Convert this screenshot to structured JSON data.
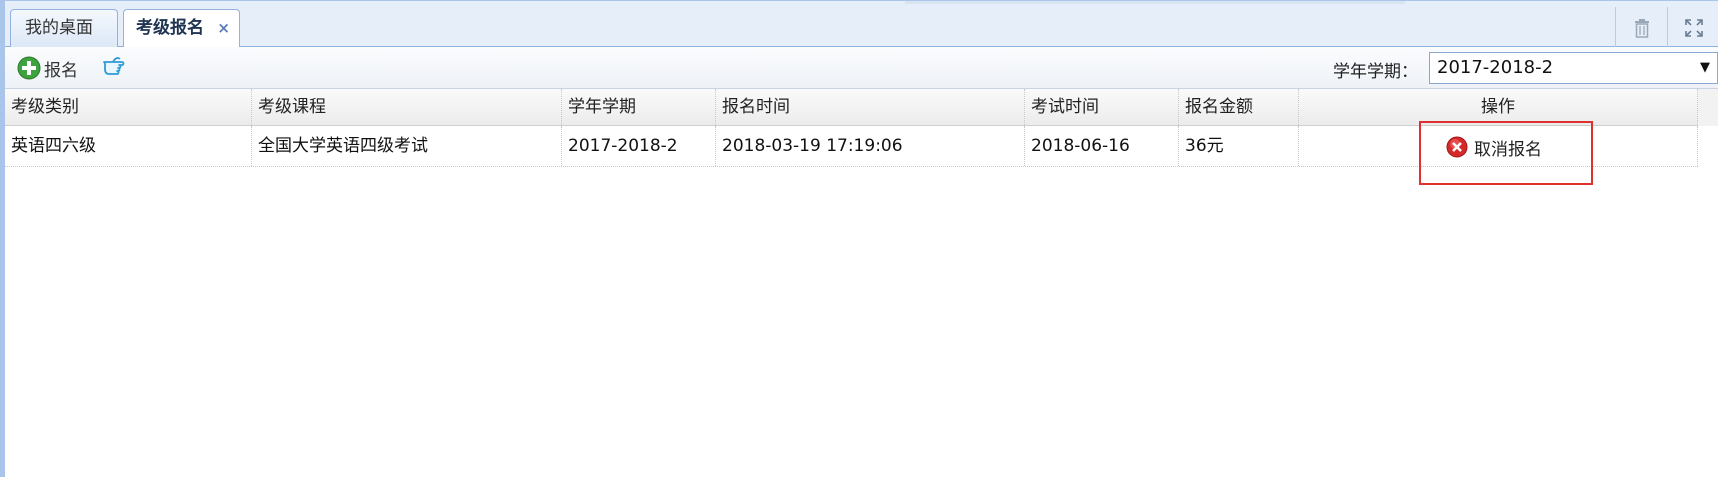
{
  "tabs": [
    {
      "label": "我的桌面",
      "active": false
    },
    {
      "label": "考级报名",
      "active": true,
      "close": "×"
    }
  ],
  "toolbar": {
    "register_label": "报名",
    "term_label": "学年学期：",
    "term_selected": "2017-2018-2"
  },
  "table": {
    "headers": [
      "考级类别",
      "考级课程",
      "学年学期",
      "报名时间",
      "考试时间",
      "报名金额",
      "操作"
    ],
    "rows": [
      {
        "category": "英语四六级",
        "course": "全国大学英语四级考试",
        "term": "2017-2018-2",
        "register_time": "2018-03-19 17:19:06",
        "exam_time": "2018-06-16",
        "fee": "36元",
        "action": "取消报名"
      }
    ]
  },
  "colors": {
    "accent": "#e03131",
    "tab_border": "#93b3de",
    "tabstrip_bg": "#e6eef9"
  },
  "icons": [
    "plus-icon",
    "pointing-hand-icon",
    "trash-icon",
    "fullscreen-icon",
    "cancel-x-icon",
    "dropdown-arrow-icon"
  ]
}
